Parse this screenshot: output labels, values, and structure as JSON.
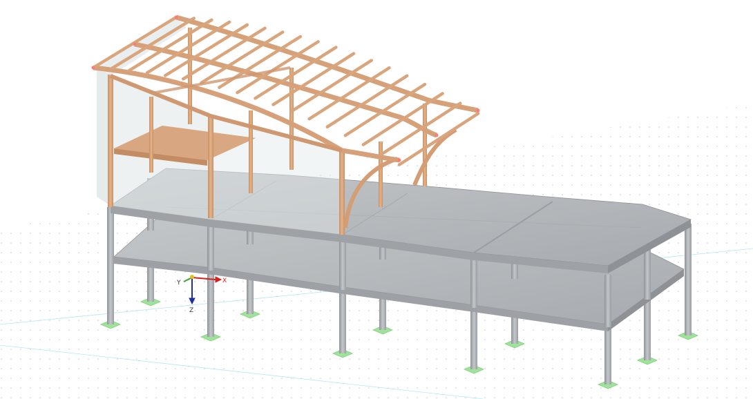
{
  "viewport": {
    "name": "3D model view",
    "background": "#ffffff"
  },
  "coordinate_system": {
    "x_label": "X",
    "y_label": "Y",
    "z_label": "Z",
    "x_color": "#d62020",
    "y_color": "#2fa52f",
    "z_color": "#1f2f9c"
  },
  "materials": {
    "concrete_slab": "#b9bcbf",
    "concrete_slab_dark": "#9ea2a6",
    "concrete_column": "#aeb2b6",
    "timber": "#d9a57c",
    "timber_dark": "#c38c63",
    "glazing": "#dfe6e6",
    "support": "#9ee39a",
    "node": "#ff7b7b",
    "grid_dot": "#c8c8c8",
    "grid_line": "#a8e4ec"
  }
}
